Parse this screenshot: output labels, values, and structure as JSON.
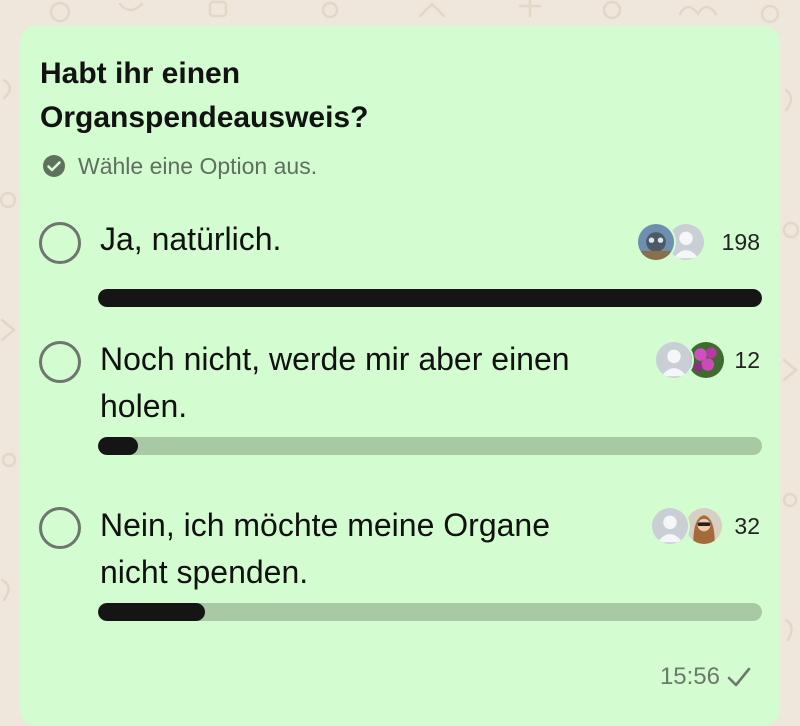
{
  "poll": {
    "question": "Habt ihr einen Organspendeausweis?",
    "hint": "Wähle eine Option aus.",
    "options": [
      {
        "label": "Ja, natürlich.",
        "count": "198",
        "votes": 198
      },
      {
        "label": "Noch nicht, werde mir aber einen holen.",
        "count": "12",
        "votes": 12
      },
      {
        "label": "Nein, ich möchte meine Organe nicht spenden.",
        "count": "32",
        "votes": 32
      }
    ],
    "timestamp": "15:56",
    "status_icon": "single-check-icon"
  },
  "colors": {
    "bubble": "#d3fdd0",
    "bar_fill": "#151515",
    "bar_track": "#a9c9a5",
    "wallpaper": "#efe7db"
  }
}
